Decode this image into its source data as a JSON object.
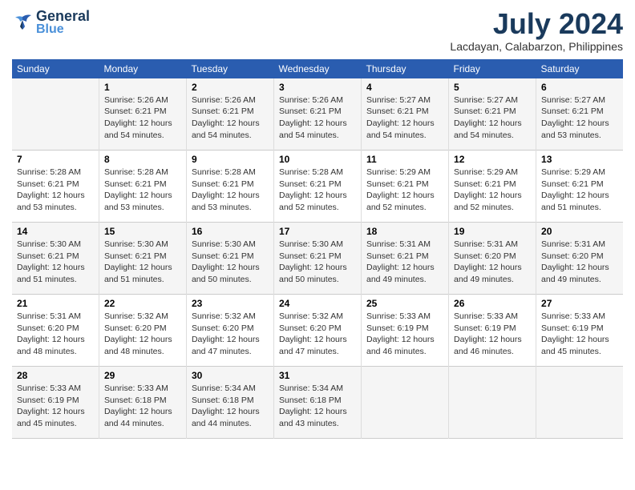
{
  "header": {
    "logo_line1": "General",
    "logo_line2": "Blue",
    "month_year": "July 2024",
    "location": "Lacdayan, Calabarzon, Philippines"
  },
  "days_of_week": [
    "Sunday",
    "Monday",
    "Tuesday",
    "Wednesday",
    "Thursday",
    "Friday",
    "Saturday"
  ],
  "weeks": [
    [
      {
        "day": "",
        "info": ""
      },
      {
        "day": "1",
        "info": "Sunrise: 5:26 AM\nSunset: 6:21 PM\nDaylight: 12 hours\nand 54 minutes."
      },
      {
        "day": "2",
        "info": "Sunrise: 5:26 AM\nSunset: 6:21 PM\nDaylight: 12 hours\nand 54 minutes."
      },
      {
        "day": "3",
        "info": "Sunrise: 5:26 AM\nSunset: 6:21 PM\nDaylight: 12 hours\nand 54 minutes."
      },
      {
        "day": "4",
        "info": "Sunrise: 5:27 AM\nSunset: 6:21 PM\nDaylight: 12 hours\nand 54 minutes."
      },
      {
        "day": "5",
        "info": "Sunrise: 5:27 AM\nSunset: 6:21 PM\nDaylight: 12 hours\nand 54 minutes."
      },
      {
        "day": "6",
        "info": "Sunrise: 5:27 AM\nSunset: 6:21 PM\nDaylight: 12 hours\nand 53 minutes."
      }
    ],
    [
      {
        "day": "7",
        "info": "Sunrise: 5:28 AM\nSunset: 6:21 PM\nDaylight: 12 hours\nand 53 minutes."
      },
      {
        "day": "8",
        "info": "Sunrise: 5:28 AM\nSunset: 6:21 PM\nDaylight: 12 hours\nand 53 minutes."
      },
      {
        "day": "9",
        "info": "Sunrise: 5:28 AM\nSunset: 6:21 PM\nDaylight: 12 hours\nand 53 minutes."
      },
      {
        "day": "10",
        "info": "Sunrise: 5:28 AM\nSunset: 6:21 PM\nDaylight: 12 hours\nand 52 minutes."
      },
      {
        "day": "11",
        "info": "Sunrise: 5:29 AM\nSunset: 6:21 PM\nDaylight: 12 hours\nand 52 minutes."
      },
      {
        "day": "12",
        "info": "Sunrise: 5:29 AM\nSunset: 6:21 PM\nDaylight: 12 hours\nand 52 minutes."
      },
      {
        "day": "13",
        "info": "Sunrise: 5:29 AM\nSunset: 6:21 PM\nDaylight: 12 hours\nand 51 minutes."
      }
    ],
    [
      {
        "day": "14",
        "info": "Sunrise: 5:30 AM\nSunset: 6:21 PM\nDaylight: 12 hours\nand 51 minutes."
      },
      {
        "day": "15",
        "info": "Sunrise: 5:30 AM\nSunset: 6:21 PM\nDaylight: 12 hours\nand 51 minutes."
      },
      {
        "day": "16",
        "info": "Sunrise: 5:30 AM\nSunset: 6:21 PM\nDaylight: 12 hours\nand 50 minutes."
      },
      {
        "day": "17",
        "info": "Sunrise: 5:30 AM\nSunset: 6:21 PM\nDaylight: 12 hours\nand 50 minutes."
      },
      {
        "day": "18",
        "info": "Sunrise: 5:31 AM\nSunset: 6:21 PM\nDaylight: 12 hours\nand 49 minutes."
      },
      {
        "day": "19",
        "info": "Sunrise: 5:31 AM\nSunset: 6:20 PM\nDaylight: 12 hours\nand 49 minutes."
      },
      {
        "day": "20",
        "info": "Sunrise: 5:31 AM\nSunset: 6:20 PM\nDaylight: 12 hours\nand 49 minutes."
      }
    ],
    [
      {
        "day": "21",
        "info": "Sunrise: 5:31 AM\nSunset: 6:20 PM\nDaylight: 12 hours\nand 48 minutes."
      },
      {
        "day": "22",
        "info": "Sunrise: 5:32 AM\nSunset: 6:20 PM\nDaylight: 12 hours\nand 48 minutes."
      },
      {
        "day": "23",
        "info": "Sunrise: 5:32 AM\nSunset: 6:20 PM\nDaylight: 12 hours\nand 47 minutes."
      },
      {
        "day": "24",
        "info": "Sunrise: 5:32 AM\nSunset: 6:20 PM\nDaylight: 12 hours\nand 47 minutes."
      },
      {
        "day": "25",
        "info": "Sunrise: 5:33 AM\nSunset: 6:19 PM\nDaylight: 12 hours\nand 46 minutes."
      },
      {
        "day": "26",
        "info": "Sunrise: 5:33 AM\nSunset: 6:19 PM\nDaylight: 12 hours\nand 46 minutes."
      },
      {
        "day": "27",
        "info": "Sunrise: 5:33 AM\nSunset: 6:19 PM\nDaylight: 12 hours\nand 45 minutes."
      }
    ],
    [
      {
        "day": "28",
        "info": "Sunrise: 5:33 AM\nSunset: 6:19 PM\nDaylight: 12 hours\nand 45 minutes."
      },
      {
        "day": "29",
        "info": "Sunrise: 5:33 AM\nSunset: 6:18 PM\nDaylight: 12 hours\nand 44 minutes."
      },
      {
        "day": "30",
        "info": "Sunrise: 5:34 AM\nSunset: 6:18 PM\nDaylight: 12 hours\nand 44 minutes."
      },
      {
        "day": "31",
        "info": "Sunrise: 5:34 AM\nSunset: 6:18 PM\nDaylight: 12 hours\nand 43 minutes."
      },
      {
        "day": "",
        "info": ""
      },
      {
        "day": "",
        "info": ""
      },
      {
        "day": "",
        "info": ""
      }
    ]
  ]
}
